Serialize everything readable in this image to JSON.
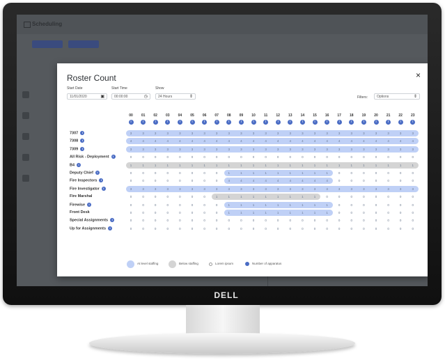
{
  "background_app": {
    "title": "Scheduling"
  },
  "modal": {
    "title": "Roster Count",
    "close_label": "×",
    "start_date": {
      "label": "Start Date",
      "value": "11/01/2020"
    },
    "start_time": {
      "label": "Start Time",
      "value": "00:00:00"
    },
    "show": {
      "label": "Show",
      "value": "24 Hours"
    },
    "filters": {
      "label": "Filters:",
      "value": "Options"
    },
    "hours": [
      "00",
      "01",
      "02",
      "03",
      "04",
      "05",
      "06",
      "07",
      "08",
      "09",
      "10",
      "11",
      "12",
      "13",
      "14",
      "15",
      "16",
      "17",
      "18",
      "19",
      "20",
      "21",
      "22",
      "23"
    ],
    "rows": [
      {
        "label": "7307",
        "info": true,
        "band": "blue",
        "band_start": 0,
        "band_end": 23,
        "values": [
          3,
          3,
          3,
          3,
          3,
          3,
          3,
          3,
          3,
          3,
          3,
          3,
          3,
          3,
          3,
          3,
          3,
          3,
          3,
          3,
          3,
          3,
          3,
          3
        ]
      },
      {
        "label": "7308",
        "info": true,
        "band": "blue",
        "band_start": 0,
        "band_end": 23,
        "values": [
          4,
          4,
          4,
          4,
          4,
          4,
          4,
          4,
          4,
          4,
          4,
          4,
          4,
          4,
          4,
          4,
          4,
          4,
          4,
          4,
          4,
          4,
          4,
          4
        ]
      },
      {
        "label": "7309",
        "info": true,
        "band": "blue",
        "band_start": 0,
        "band_end": 23,
        "values": [
          3,
          3,
          3,
          3,
          3,
          3,
          3,
          3,
          3,
          3,
          3,
          3,
          3,
          3,
          3,
          3,
          3,
          3,
          3,
          3,
          3,
          3,
          3,
          3
        ]
      },
      {
        "label": "All Risk - Deployment",
        "info": true,
        "band": "none",
        "values": [
          0,
          0,
          0,
          0,
          0,
          0,
          0,
          0,
          0,
          0,
          0,
          0,
          0,
          0,
          0,
          0,
          0,
          0,
          0,
          0,
          0,
          0,
          0,
          0
        ]
      },
      {
        "label": "B4",
        "info": true,
        "band": "gray",
        "band_start": 0,
        "band_end": 23,
        "values": [
          1,
          1,
          1,
          1,
          1,
          1,
          1,
          1,
          1,
          1,
          1,
          1,
          1,
          1,
          1,
          1,
          1,
          1,
          1,
          1,
          1,
          1,
          1,
          1
        ]
      },
      {
        "label": "Deputy Chief",
        "info": true,
        "band": "blue",
        "band_start": 8,
        "band_end": 16,
        "values": [
          0,
          0,
          0,
          0,
          0,
          0,
          0,
          0,
          1,
          1,
          1,
          1,
          1,
          1,
          1,
          1,
          1,
          0,
          0,
          0,
          0,
          0,
          0,
          0
        ]
      },
      {
        "label": "Fire Inspectors",
        "info": true,
        "band": "blue",
        "band_start": 8,
        "band_end": 16,
        "values": [
          0,
          0,
          0,
          0,
          0,
          0,
          0,
          0,
          4,
          4,
          4,
          4,
          4,
          4,
          4,
          4,
          4,
          0,
          0,
          0,
          0,
          0,
          0,
          0
        ]
      },
      {
        "label": "Fire Investigator",
        "info": true,
        "band": "blue",
        "band_start": 0,
        "band_end": 23,
        "values": [
          3,
          3,
          3,
          3,
          3,
          3,
          3,
          3,
          3,
          3,
          3,
          3,
          3,
          3,
          3,
          3,
          3,
          3,
          3,
          3,
          3,
          3,
          3,
          3
        ]
      },
      {
        "label": "Fire Marshal",
        "info": false,
        "band": "gray",
        "band_start": 7,
        "band_end": 15,
        "values": [
          0,
          0,
          0,
          0,
          0,
          0,
          0,
          1,
          1,
          1,
          1,
          1,
          1,
          1,
          1,
          1,
          0,
          0,
          0,
          0,
          0,
          0,
          0,
          0
        ]
      },
      {
        "label": "Firewise",
        "info": true,
        "band": "blue",
        "band_start": 8,
        "band_end": 16,
        "values": [
          0,
          0,
          0,
          0,
          0,
          0,
          0,
          0,
          1,
          1,
          1,
          1,
          1,
          1,
          1,
          1,
          1,
          0,
          0,
          0,
          0,
          0,
          0,
          0
        ]
      },
      {
        "label": "Front Desk",
        "info": false,
        "band": "blue",
        "band_start": 8,
        "band_end": 16,
        "values": [
          0,
          0,
          0,
          0,
          0,
          0,
          0,
          0,
          1,
          1,
          1,
          1,
          1,
          1,
          1,
          1,
          1,
          0,
          0,
          0,
          0,
          0,
          0,
          0
        ]
      },
      {
        "label": "Special Assignments",
        "info": true,
        "band": "none",
        "values": [
          0,
          0,
          0,
          0,
          0,
          0,
          0,
          0,
          0,
          0,
          0,
          0,
          0,
          0,
          0,
          0,
          0,
          0,
          0,
          0,
          0,
          0,
          0,
          0
        ]
      },
      {
        "label": "Up for Assignments",
        "info": true,
        "band": "none",
        "values": [
          0,
          0,
          0,
          0,
          0,
          0,
          0,
          0,
          0,
          0,
          0,
          0,
          0,
          0,
          0,
          0,
          0,
          0,
          0,
          0,
          0,
          0,
          0,
          0
        ]
      }
    ],
    "legend": [
      {
        "label": "At level staffing",
        "style": "blue-circle"
      },
      {
        "label": "Below staffing",
        "style": "gray-circle"
      },
      {
        "label": "Lorem ipsum",
        "style": "small-dot"
      },
      {
        "label": "Number of apparatus",
        "style": "dark-dot"
      }
    ]
  },
  "monitor": {
    "brand": "DELL"
  },
  "colors": {
    "accent": "#4a6cc4",
    "band_blue": "#bfd0f6",
    "band_gray": "#d4d4d4",
    "overlay": "#55595d"
  }
}
